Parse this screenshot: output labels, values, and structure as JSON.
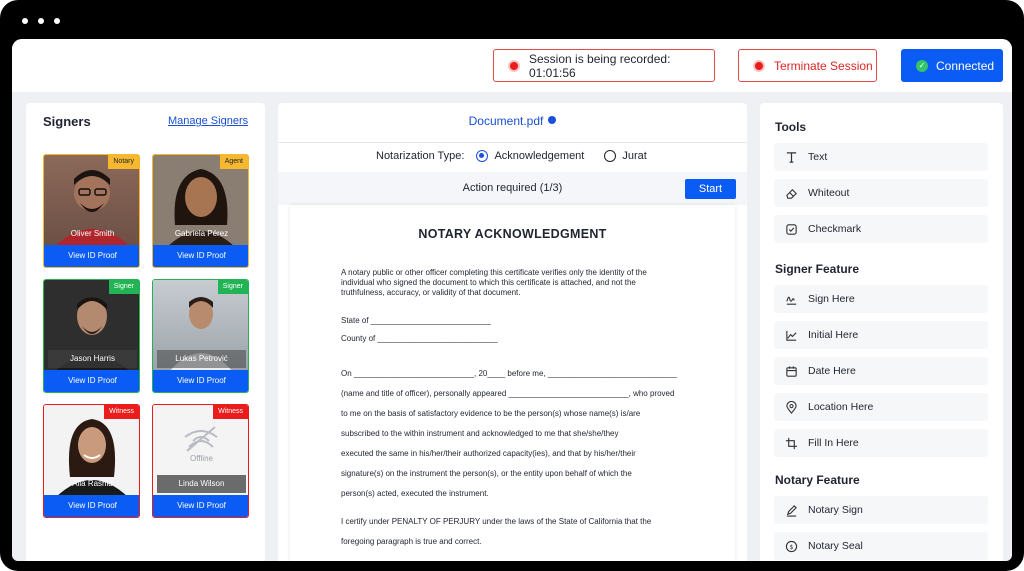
{
  "session": {
    "recording_label": "Session is being recorded: 01:01:56",
    "terminate_label": "Terminate Session",
    "connected_label": "Connected"
  },
  "signers": {
    "title": "Signers",
    "manage_label": "Manage Signers",
    "cards": [
      {
        "name": "Oliver Smith",
        "role": "Notary",
        "proof_label": "View ID Proof",
        "status": ""
      },
      {
        "name": "Gabriela Pérez",
        "role": "Agent",
        "proof_label": "View ID Proof",
        "status": ""
      },
      {
        "name": "Jason Harris",
        "role": "Signer",
        "proof_label": "View ID Proof",
        "status": ""
      },
      {
        "name": "Lukas Petrović",
        "role": "Signer",
        "proof_label": "View ID Proof",
        "status": ""
      },
      {
        "name": "Alia Rashid",
        "role": "Witness",
        "proof_label": "View ID Proof",
        "status": ""
      },
      {
        "name": "Linda Wilson",
        "role": "Witness",
        "proof_label": "View ID Proof",
        "status": "Offline"
      }
    ]
  },
  "document": {
    "filename": "Document.pdf",
    "notarization_type_label": "Notarization Type:",
    "options": [
      "Acknowledgement",
      "Jurat"
    ],
    "selected_option": "Acknowledgement",
    "action_required": "Action required (1/3)",
    "start_label": "Start",
    "page": {
      "title": "NOTARY ACKNOWLEDGMENT",
      "intro": [
        "A notary public or other officer completing this certificate verifies only the identity of the",
        "individual who signed the document to which this certificate is attached, and not the",
        "truthfulness, accuracy, or validity of that document."
      ],
      "state_line": "State of ___________________________",
      "county_line": "County of ___________________________",
      "body": [
        "On ___________________________, 20____ before me, _____________________________",
        "(name and title of officer), personally appeared ___________________________, who proved",
        "to me on the basis of satisfactory evidence to be the person(s) whose name(s) is/are",
        "subscribed to the within instrument and acknowledged to me that she/she/they",
        "executed the same in his/her/their authorized capacity(ies), and that by his/her/their",
        "signature(s) on the instrument the person(s), or the entity upon behalf of which the",
        "person(s) acted, executed the instrument."
      ],
      "perjury": [
        "I certify under PENALTY OF PERJURY under the laws of the State of California that the",
        "foregoing paragraph is true and correct."
      ]
    }
  },
  "tools_panel": {
    "title": "Tools",
    "tools": [
      {
        "label": "Text",
        "icon": "text-icon"
      },
      {
        "label": "Whiteout",
        "icon": "eraser-icon"
      },
      {
        "label": "Checkmark",
        "icon": "checkbox-icon"
      }
    ],
    "signer_title": "Signer Feature",
    "signer_tools": [
      {
        "label": "Sign Here",
        "icon": "signature-icon"
      },
      {
        "label": "Initial Here",
        "icon": "initial-icon"
      },
      {
        "label": "Date Here",
        "icon": "calendar-icon"
      },
      {
        "label": "Location Here",
        "icon": "location-icon"
      },
      {
        "label": "Fill In Here",
        "icon": "fill-icon"
      }
    ],
    "notary_title": "Notary Feature",
    "notary_tools": [
      {
        "label": "Notary Sign",
        "icon": "pen-icon"
      },
      {
        "label": "Notary Seal",
        "icon": "seal-icon"
      }
    ]
  },
  "colors": {
    "accent": "#0a5cf5",
    "danger": "#e02424",
    "notary_tag": "#f5b82e",
    "signer_tag": "#22b454",
    "witness_tag": "#ea1c1c"
  }
}
